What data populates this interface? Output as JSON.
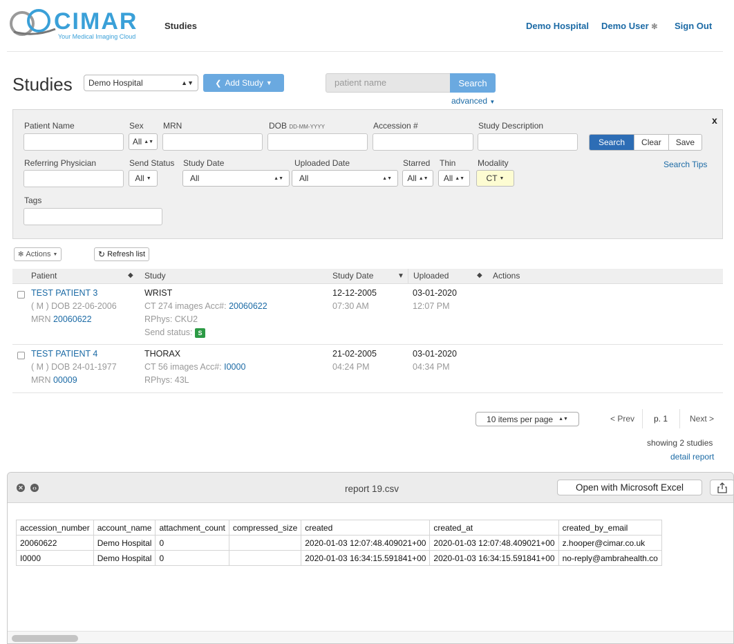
{
  "header": {
    "logo_text": "CIMAR",
    "logo_subtitle": "Your Medical Imaging Cloud",
    "nav_studies": "Studies",
    "account": "Demo Hospital",
    "user": "Demo User",
    "user_icon": "gear-icon",
    "sign_out": "Sign Out"
  },
  "toolbar": {
    "title": "Studies",
    "account_select": "Demo Hospital",
    "add_study": "Add Study",
    "search_placeholder": "patient name",
    "search_btn": "Search",
    "advanced": "advanced"
  },
  "filters": {
    "close": "x",
    "labels": {
      "patient_name": "Patient Name",
      "sex": "Sex",
      "mrn": "MRN",
      "dob": "DOB",
      "dob_format": "DD-MM-YYYY",
      "accession": "Accession #",
      "study_description": "Study Description",
      "referring_physician": "Referring Physician",
      "send_status": "Send Status",
      "study_date": "Study Date",
      "uploaded_date": "Uploaded Date",
      "starred": "Starred",
      "thin": "Thin",
      "modality": "Modality",
      "tags": "Tags"
    },
    "values": {
      "sex": "All",
      "send_status": "All",
      "study_date": "All",
      "uploaded_date": "All",
      "starred": "All",
      "thin": "All",
      "modality": "CT"
    },
    "buttons": {
      "search": "Search",
      "clear": "Clear",
      "save": "Save"
    },
    "search_tips": "Search Tips"
  },
  "list_actions": {
    "actions": "Actions",
    "refresh": "Refresh list"
  },
  "table": {
    "headers": {
      "patient": "Patient",
      "study": "Study",
      "study_date": "Study Date",
      "uploaded": "Uploaded",
      "actions": "Actions"
    },
    "rows": [
      {
        "patient": "TEST PATIENT 3",
        "sex_dob": "( M ) DOB 22-06-2006",
        "mrn_label": "MRN",
        "mrn": "20060622",
        "study": "WRIST",
        "meta": "CT  274 images  Acc#:",
        "acc": "20060622",
        "rphys": "RPhys: CKU2",
        "send_status": "Send status:",
        "send_badge": "S",
        "study_date": "12-12-2005",
        "study_time": "07:30 AM",
        "uploaded_date": "03-01-2020",
        "uploaded_time": "12:07 PM"
      },
      {
        "patient": "TEST PATIENT 4",
        "sex_dob": "( M ) DOB 24-01-1977",
        "mrn_label": "MRN",
        "mrn": "00009",
        "study": "THORAX",
        "meta": "CT  56 images  Acc#:",
        "acc": "I0000",
        "rphys": "RPhys: 43L",
        "study_date": "21-02-2005",
        "study_time": "04:24 PM",
        "uploaded_date": "03-01-2020",
        "uploaded_time": "04:34 PM"
      }
    ]
  },
  "pager": {
    "per_page": "10 items per page",
    "prev": "< Prev",
    "page": "p. 1",
    "next": "Next >",
    "showing": "showing 2 studies",
    "detail_report": "detail report"
  },
  "csv_window": {
    "title": "report 19.csv",
    "open_with": "Open with Microsoft Excel",
    "columns": [
      "accession_number",
      "account_name",
      "attachment_count",
      "compressed_size",
      "created",
      "created_at",
      "created_by_email"
    ],
    "rows": [
      [
        "20060622",
        "Demo Hospital",
        "0",
        "",
        "2020-01-03 12:07:48.409021+00",
        "2020-01-03 12:07:48.409021+00",
        "z.hooper@cimar.co.uk"
      ],
      [
        "I0000",
        "Demo Hospital",
        "0",
        "",
        "2020-01-03 16:34:15.591841+00",
        "2020-01-03 16:34:15.591841+00",
        "no-reply@ambrahealth.co"
      ]
    ]
  },
  "colors": {
    "link": "#1b6aa5",
    "brand": "#3aa0d8",
    "primary_button": "#2d6db5",
    "add_button": "#6aa9e0",
    "badge_green": "#2c9a45",
    "modality_highlight": "#fdfcd2"
  }
}
